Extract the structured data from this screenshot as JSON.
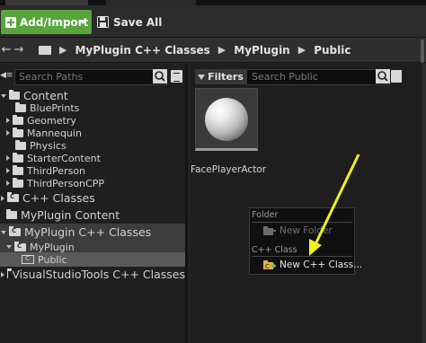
{
  "toolbar": {
    "add_import_label": "Add/Import",
    "save_all_label": "Save All"
  },
  "path": {
    "crumbs": [
      "MyPlugin C++ Classes",
      "MyPlugin",
      "Public"
    ]
  },
  "sources": {
    "search_placeholder": "Search Paths",
    "tree": {
      "content": "Content",
      "blueprints": "BluePrints",
      "geometry": "Geometry",
      "mannequin": "Mannequin",
      "physics": "Physics",
      "startercontent": "StarterContent",
      "thirdperson": "ThirdPerson",
      "thirdpersoncpp": "ThirdPersonCPP",
      "cpp_classes": "C++ Classes",
      "myplugin_content": "MyPlugin Content",
      "myplugin_cpp": "MyPlugin C++ Classes",
      "myplugin": "MyPlugin",
      "public": "Public",
      "vstools": "VisualStudioTools C++ Classes"
    }
  },
  "content": {
    "filters_label": "Filters",
    "search_placeholder": "Search Public",
    "assets": [
      {
        "name": "FacePlayerActor"
      }
    ]
  },
  "context_menu": {
    "folder_header": "Folder",
    "new_folder": "New Folder",
    "cpp_header": "C++ Class",
    "new_cpp_class": "New C++ Class..."
  },
  "colors": {
    "accent_green": "#57a53b",
    "annotation_arrow": "#f0f01e"
  }
}
